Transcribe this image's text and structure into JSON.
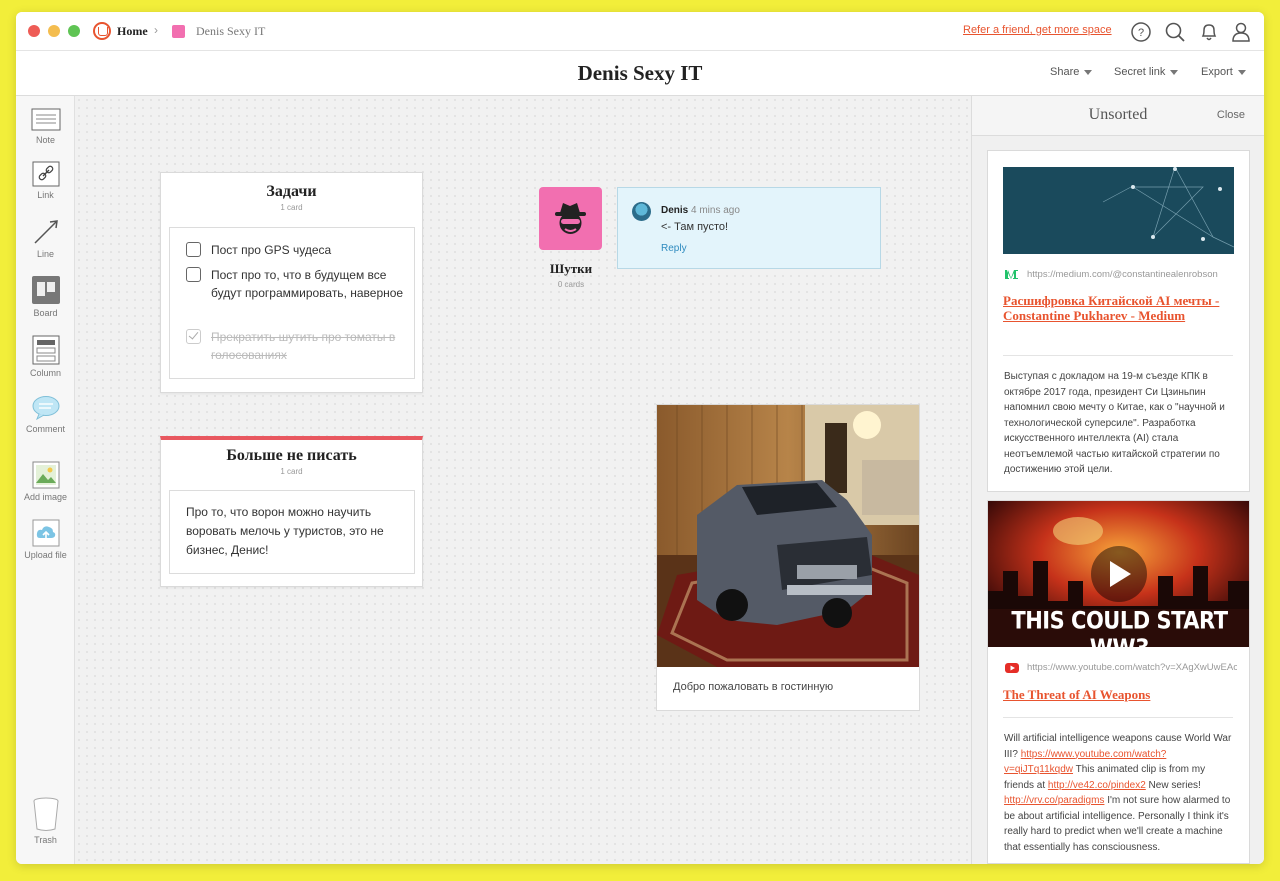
{
  "topbar": {
    "home_label": "Home",
    "breadcrumb_board": "Denis Sexy IT",
    "refer_link": "Refer a friend, get more space",
    "brand_color": "#e8542f"
  },
  "titlebar": {
    "title": "Denis Sexy IT",
    "share": "Share",
    "secret_link": "Secret link",
    "export": "Export"
  },
  "toolbar": {
    "items": [
      {
        "label": "Note",
        "icon": "note-icon"
      },
      {
        "label": "Link",
        "icon": "link-icon"
      },
      {
        "label": "Line",
        "icon": "line-icon"
      },
      {
        "label": "Board",
        "icon": "board-icon"
      },
      {
        "label": "Column",
        "icon": "column-icon"
      },
      {
        "label": "Comment",
        "icon": "comment-icon"
      },
      {
        "label": "Add image",
        "icon": "image-icon"
      },
      {
        "label": "Upload file",
        "icon": "upload-icon"
      }
    ],
    "trash": "Trash"
  },
  "canvas": {
    "tasks_column": {
      "title": "Задачи",
      "count": "1 card",
      "items": [
        {
          "text": "Пост про GPS чудеса",
          "done": false
        },
        {
          "text": "Пост про то, что в будущем все будут программировать, наверное",
          "done": false
        },
        {
          "text": "Прекратить шутить про томаты в голосованиях",
          "done": true
        }
      ]
    },
    "nomore_column": {
      "title": "Больше не писать",
      "count": "1 card",
      "accent": "#e8575f",
      "note": "Про то, что ворон можно научить воровать мелочь у туристов, это не бизнес, Денис!"
    },
    "jokes_board": {
      "title": "Шутки",
      "count": "0 cards",
      "color": "#f26fb0"
    },
    "comment": {
      "author": "Denis",
      "time": "4 mins ago",
      "text": "<- Там пусто!",
      "reply": "Reply"
    },
    "image_card": {
      "caption": "Добро пожаловать в гостинную"
    }
  },
  "panel": {
    "title": "Unsorted",
    "close": "Close",
    "link1": {
      "url": "https://medium.com/@constantinealenrobson",
      "title": "Расшифровка Китайской AI мечты - Constantine Pukharev - Medium",
      "description": "Выступая с докладом на 19-м съезде КПК в октябре 2017 года, президент Си Цзиньпин напомнил свою мечту о Китае, как о \"научной и технологической суперсиле\". Разработка искусственного интеллекта (AI) стала неотъемлемой частью китайской стратегии по достижению этой цели."
    },
    "link2": {
      "url": "https://www.youtube.com/watch?v=XAgXwUwEAo",
      "thumbnail_text": "THIS COULD START WW3",
      "title": "The Threat of AI Weapons",
      "desc_1": "Will artificial intelligence weapons cause World War III? ",
      "desc_link1": "https://www.youtube.com/watch?v=qiJTq11kqdw",
      "desc_2": " This animated clip is from my friends at ",
      "desc_link2": "http://ve42.co/pindex2",
      "desc_3": " New series! ",
      "desc_link3": "http://vrv.co/paradigms",
      "desc_4": " I'm not sure how alarmed to be about artificial intelligence. Personally I think it's really hard to predict when we'll create a machine that essentially has consciousness."
    }
  }
}
